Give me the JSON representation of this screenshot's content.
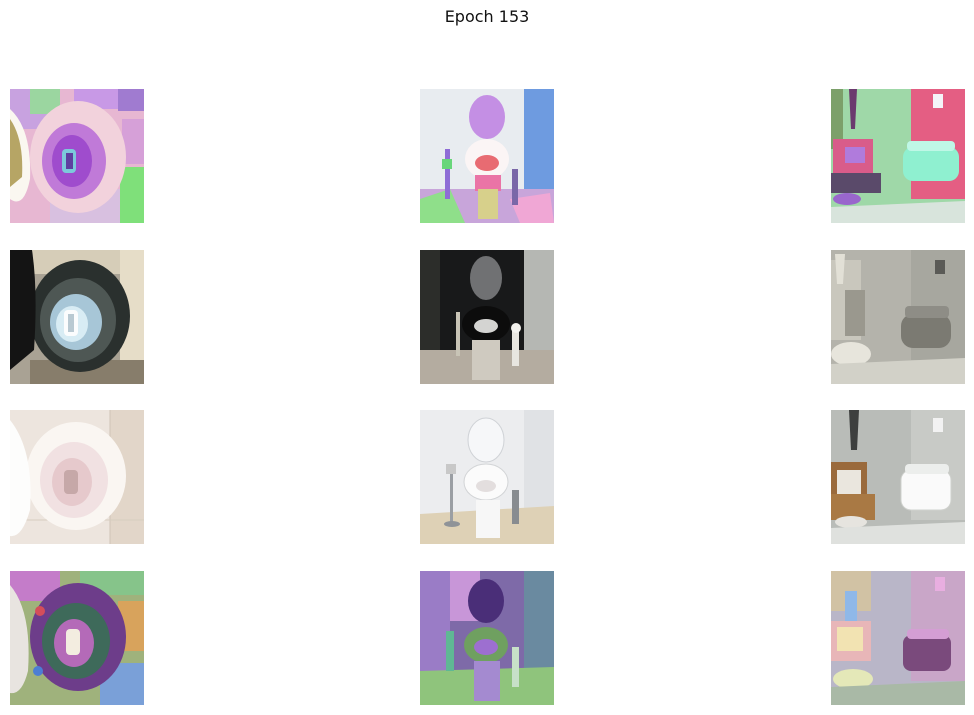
{
  "figure": {
    "title": "Epoch 153"
  },
  "grid": {
    "rows": 4,
    "cols": 3,
    "panels": [
      {
        "row": 1,
        "col": 1,
        "subject": "toilet-seat-closeup",
        "style": "pastel-colorized"
      },
      {
        "row": 1,
        "col": 2,
        "subject": "toilet-front-view",
        "style": "pastel-colorized"
      },
      {
        "row": 1,
        "col": 3,
        "subject": "wall-mounted-toilet-bathroom",
        "style": "pastel-colorized"
      },
      {
        "row": 2,
        "col": 1,
        "subject": "toilet-seat-closeup",
        "style": "dark-inverted"
      },
      {
        "row": 2,
        "col": 2,
        "subject": "toilet-front-view",
        "style": "dark-inverted"
      },
      {
        "row": 2,
        "col": 3,
        "subject": "wall-mounted-toilet-bathroom",
        "style": "grey-desaturated"
      },
      {
        "row": 3,
        "col": 1,
        "subject": "toilet-seat-closeup",
        "style": "photographic"
      },
      {
        "row": 3,
        "col": 2,
        "subject": "toilet-front-view",
        "style": "photographic"
      },
      {
        "row": 3,
        "col": 3,
        "subject": "wall-mounted-toilet-bathroom",
        "style": "photographic"
      },
      {
        "row": 4,
        "col": 1,
        "subject": "toilet-seat-closeup",
        "style": "psychedelic-noise"
      },
      {
        "row": 4,
        "col": 2,
        "subject": "toilet-front-view",
        "style": "psychedelic-noise"
      },
      {
        "row": 4,
        "col": 3,
        "subject": "wall-mounted-toilet-bathroom",
        "style": "psychedelic-noise"
      }
    ]
  }
}
